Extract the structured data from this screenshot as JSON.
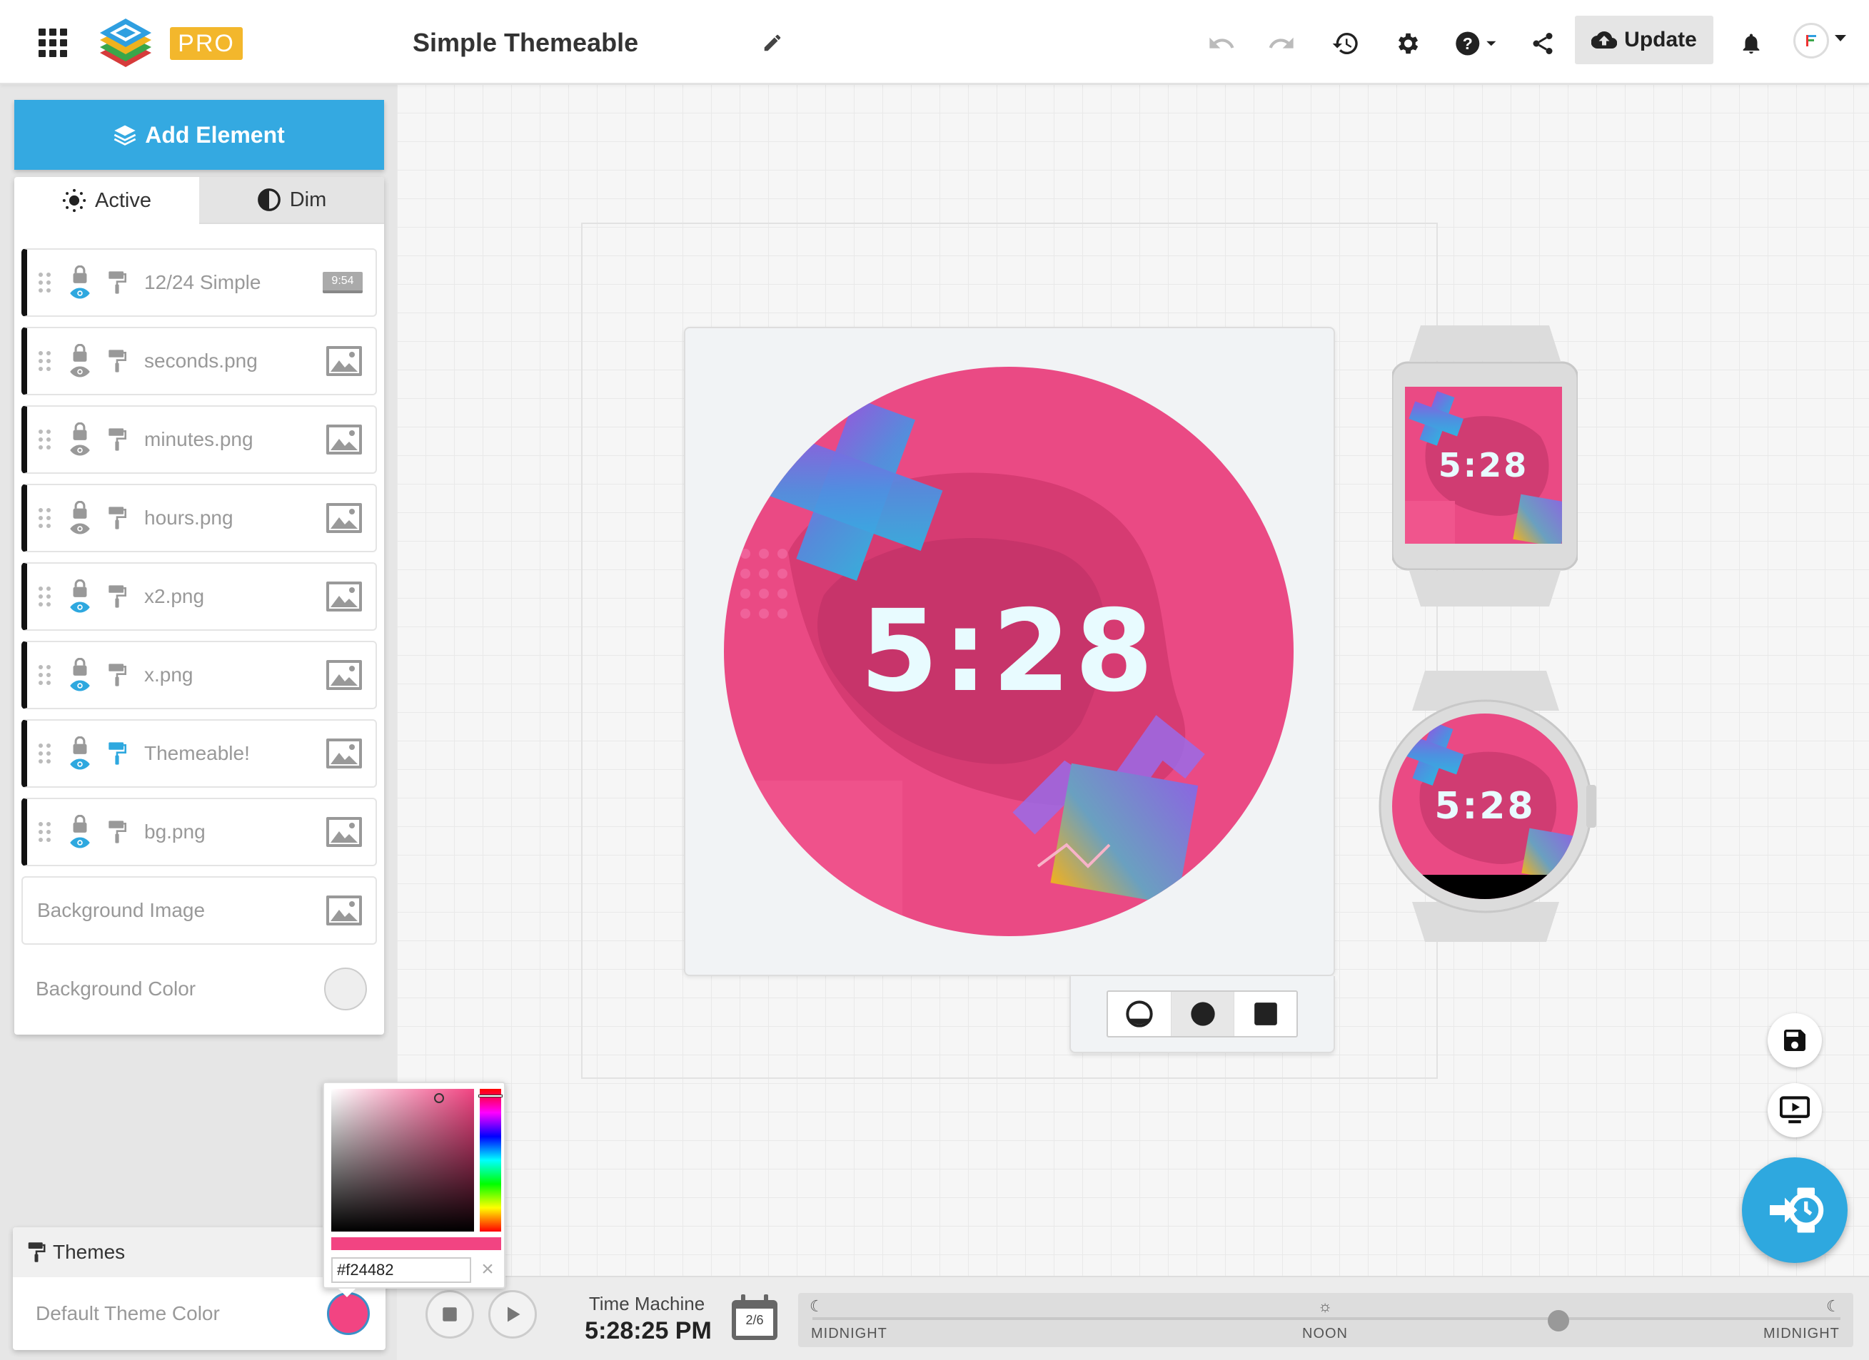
{
  "app": {
    "badge": "PRO",
    "doc_title": "Simple Themeable",
    "update_label": "Update"
  },
  "colors": {
    "accent": "#34a9e1",
    "face_pink": "#e94a83",
    "theme": "#f24482"
  },
  "left": {
    "add_element": "Add Element",
    "tabs": [
      {
        "label": "Active",
        "icon": "sun-icon"
      },
      {
        "label": "Dim",
        "icon": "contrast-icon"
      }
    ],
    "layers": [
      {
        "name": "12/24 Simple",
        "thumb": "9:54",
        "type": "clock",
        "visible": true
      },
      {
        "name": "seconds.png",
        "type": "image",
        "visible": false
      },
      {
        "name": "minutes.png",
        "type": "image",
        "visible": false
      },
      {
        "name": "hours.png",
        "type": "image",
        "visible": false
      },
      {
        "name": "x2.png",
        "type": "image",
        "visible": true
      },
      {
        "name": "x.png",
        "type": "image",
        "visible": true
      },
      {
        "name": "Themeable!",
        "type": "image",
        "visible": true,
        "themed": true
      },
      {
        "name": "bg.png",
        "type": "image",
        "visible": true
      }
    ],
    "background_image": "Background Image",
    "background_color": "Background Color",
    "themes_title": "Themes",
    "default_theme_color": "Default Theme Color"
  },
  "picker": {
    "hex": "#f24482"
  },
  "preview": {
    "time": "5:28",
    "square_time": "5:28",
    "round_time": "5:28"
  },
  "time_machine": {
    "label": "Time Machine",
    "time": "5:28:25 PM",
    "date": "2/6",
    "timeline": {
      "start": "MIDNIGHT",
      "mid": "NOON",
      "end": "MIDNIGHT",
      "position_fraction": 0.726
    }
  }
}
